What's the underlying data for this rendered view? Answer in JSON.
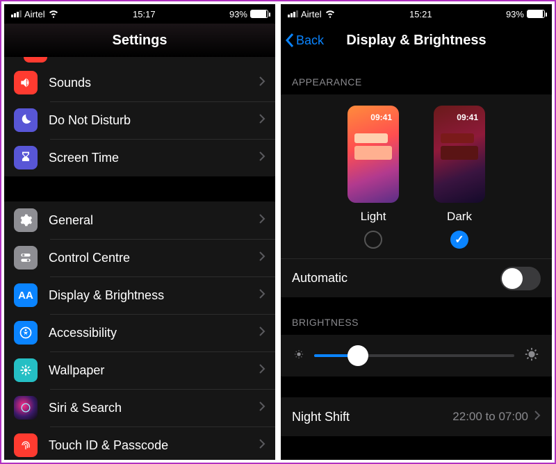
{
  "left": {
    "status": {
      "carrier": "Airtel",
      "time": "15:17",
      "battery_pct": "93%"
    },
    "title": "Settings",
    "rows": [
      {
        "id": "sounds",
        "label": "Sounds",
        "icon": "speaker",
        "color": "#ff3b30"
      },
      {
        "id": "dnd",
        "label": "Do Not Disturb",
        "icon": "moon",
        "color": "#5856d6"
      },
      {
        "id": "screen",
        "label": "Screen Time",
        "icon": "hourglass",
        "color": "#5856d6"
      }
    ],
    "rows2": [
      {
        "id": "general",
        "label": "General",
        "icon": "gear",
        "color": "#8e8e93"
      },
      {
        "id": "control",
        "label": "Control Centre",
        "icon": "toggles",
        "color": "#8e8e93"
      },
      {
        "id": "display",
        "label": "Display & Brightness",
        "icon": "AA",
        "color": "#0a84ff"
      },
      {
        "id": "access",
        "label": "Accessibility",
        "icon": "person",
        "color": "#0a84ff"
      },
      {
        "id": "wall",
        "label": "Wallpaper",
        "icon": "flower",
        "color": "#25bfc4"
      },
      {
        "id": "siri",
        "label": "Siri & Search",
        "icon": "siri",
        "color": "#1c1c1e"
      },
      {
        "id": "touchid",
        "label": "Touch ID & Passcode",
        "icon": "finger",
        "color": "#ff3b30"
      }
    ]
  },
  "right": {
    "status": {
      "carrier": "Airtel",
      "time": "15:21",
      "battery_pct": "93%"
    },
    "back": "Back",
    "title": "Display & Brightness",
    "appearance_hdr": "APPEARANCE",
    "thumb_time": "09:41",
    "light_label": "Light",
    "dark_label": "Dark",
    "selected": "dark",
    "automatic_label": "Automatic",
    "automatic_on": false,
    "brightness_hdr": "BRIGHTNESS",
    "brightness_pct": 22,
    "night_shift_label": "Night Shift",
    "night_shift_detail": "22:00 to 07:00"
  }
}
